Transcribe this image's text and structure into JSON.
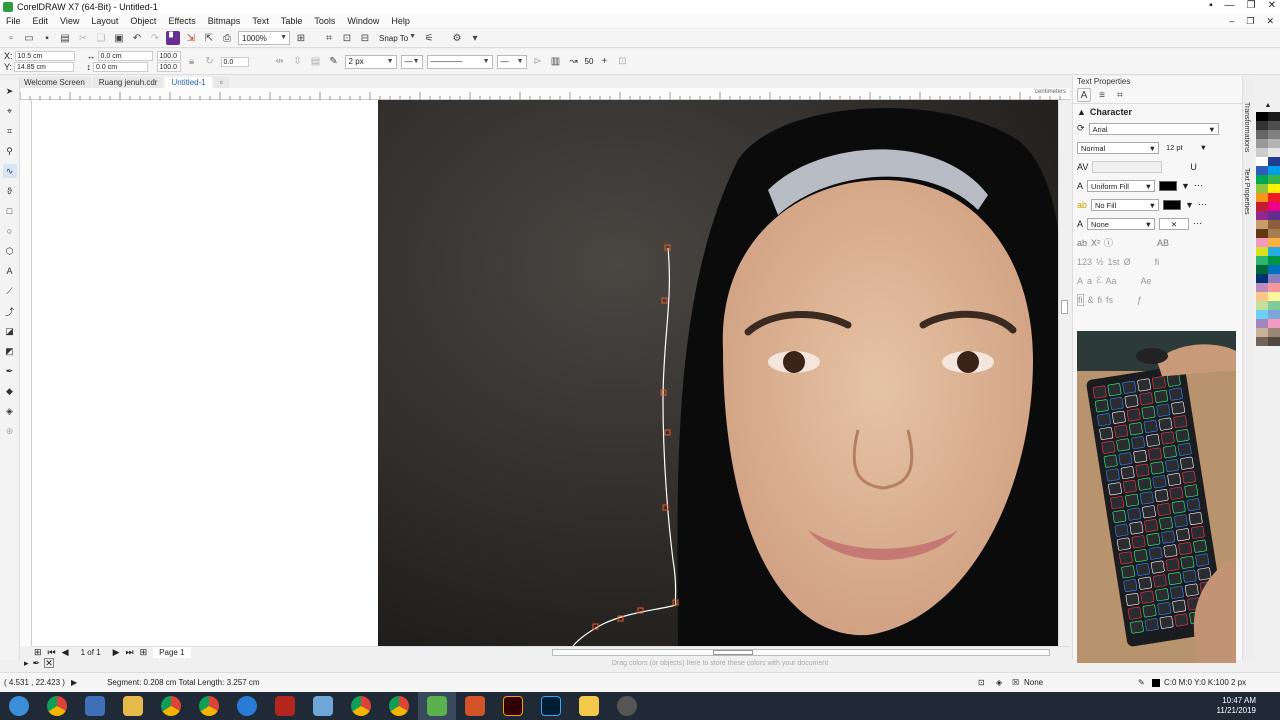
{
  "window": {
    "title": "CorelDRAW X7 (64-Bit) - Untitled-1"
  },
  "menu": [
    "File",
    "Edit",
    "View",
    "Layout",
    "Object",
    "Effects",
    "Bitmaps",
    "Text",
    "Table",
    "Tools",
    "Window",
    "Help"
  ],
  "toolbar": {
    "zoom": "1000%",
    "snap_to": "Snap To"
  },
  "propbar": {
    "x": "10.5 cm",
    "y": "14.85 cm",
    "w": "0.0 cm",
    "h": "0.0 cm",
    "sx": "100.0",
    "sy": "100.0",
    "rotation": "0.0",
    "outline_width": "2 px",
    "smoothing": "50"
  },
  "doc_tabs": [
    "Welcome Screen",
    "Ruang jenuh.cdr",
    "Untitled-1"
  ],
  "ruler": {
    "unit": "centimeters"
  },
  "pager": {
    "count": "1 of 1",
    "page": "Page 1"
  },
  "palette_hint": "Drag colors (or objects) here to store these colors with your document",
  "docker": {
    "title": "Text Properties",
    "section": "Character",
    "font": "Arial",
    "style": "Normal",
    "size": "12 pt",
    "fill": "Uniform Fill",
    "bg_fill": "No Fill",
    "outline": "None"
  },
  "status": {
    "coords": "( 4.531 , 22.423 )",
    "segment": "Segment: 0.208 cm Total Length: 3.257 cm",
    "fill": "None",
    "outline": "C:0 M:0 Y:0 K:100  2 px"
  },
  "clock": {
    "time": "10:47 AM",
    "date": "11/21/2019"
  },
  "colors": {
    "accent": "#1a5fbf",
    "palette": [
      "#000000",
      "#1a1a1a",
      "#333333",
      "#4d4d4d",
      "#666666",
      "#808080",
      "#999999",
      "#b3b3b3",
      "#cccccc",
      "#e6e6e6",
      "#ffffff",
      "#1c3f94",
      "#2e5cb8",
      "#00a0e9",
      "#00a651",
      "#39b54a",
      "#8dc63f",
      "#fff200",
      "#f7941d",
      "#ed1c24",
      "#be1e2d",
      "#ec008c",
      "#92278f",
      "#662d91",
      "#c69c6d",
      "#8b5e3c",
      "#603913",
      "#a67c52",
      "#f49ac1",
      "#fbb040",
      "#d7df23",
      "#27aae1",
      "#2bb673",
      "#009444",
      "#006838",
      "#0072bc",
      "#003471",
      "#8781bd",
      "#bd8cbf",
      "#f5989d",
      "#fdc689",
      "#fff799",
      "#c4df9b",
      "#82ca9c",
      "#6dcff6",
      "#7da7d9",
      "#a187be",
      "#f49ac2",
      "#c7b299",
      "#998675",
      "#736357",
      "#534741"
    ]
  }
}
